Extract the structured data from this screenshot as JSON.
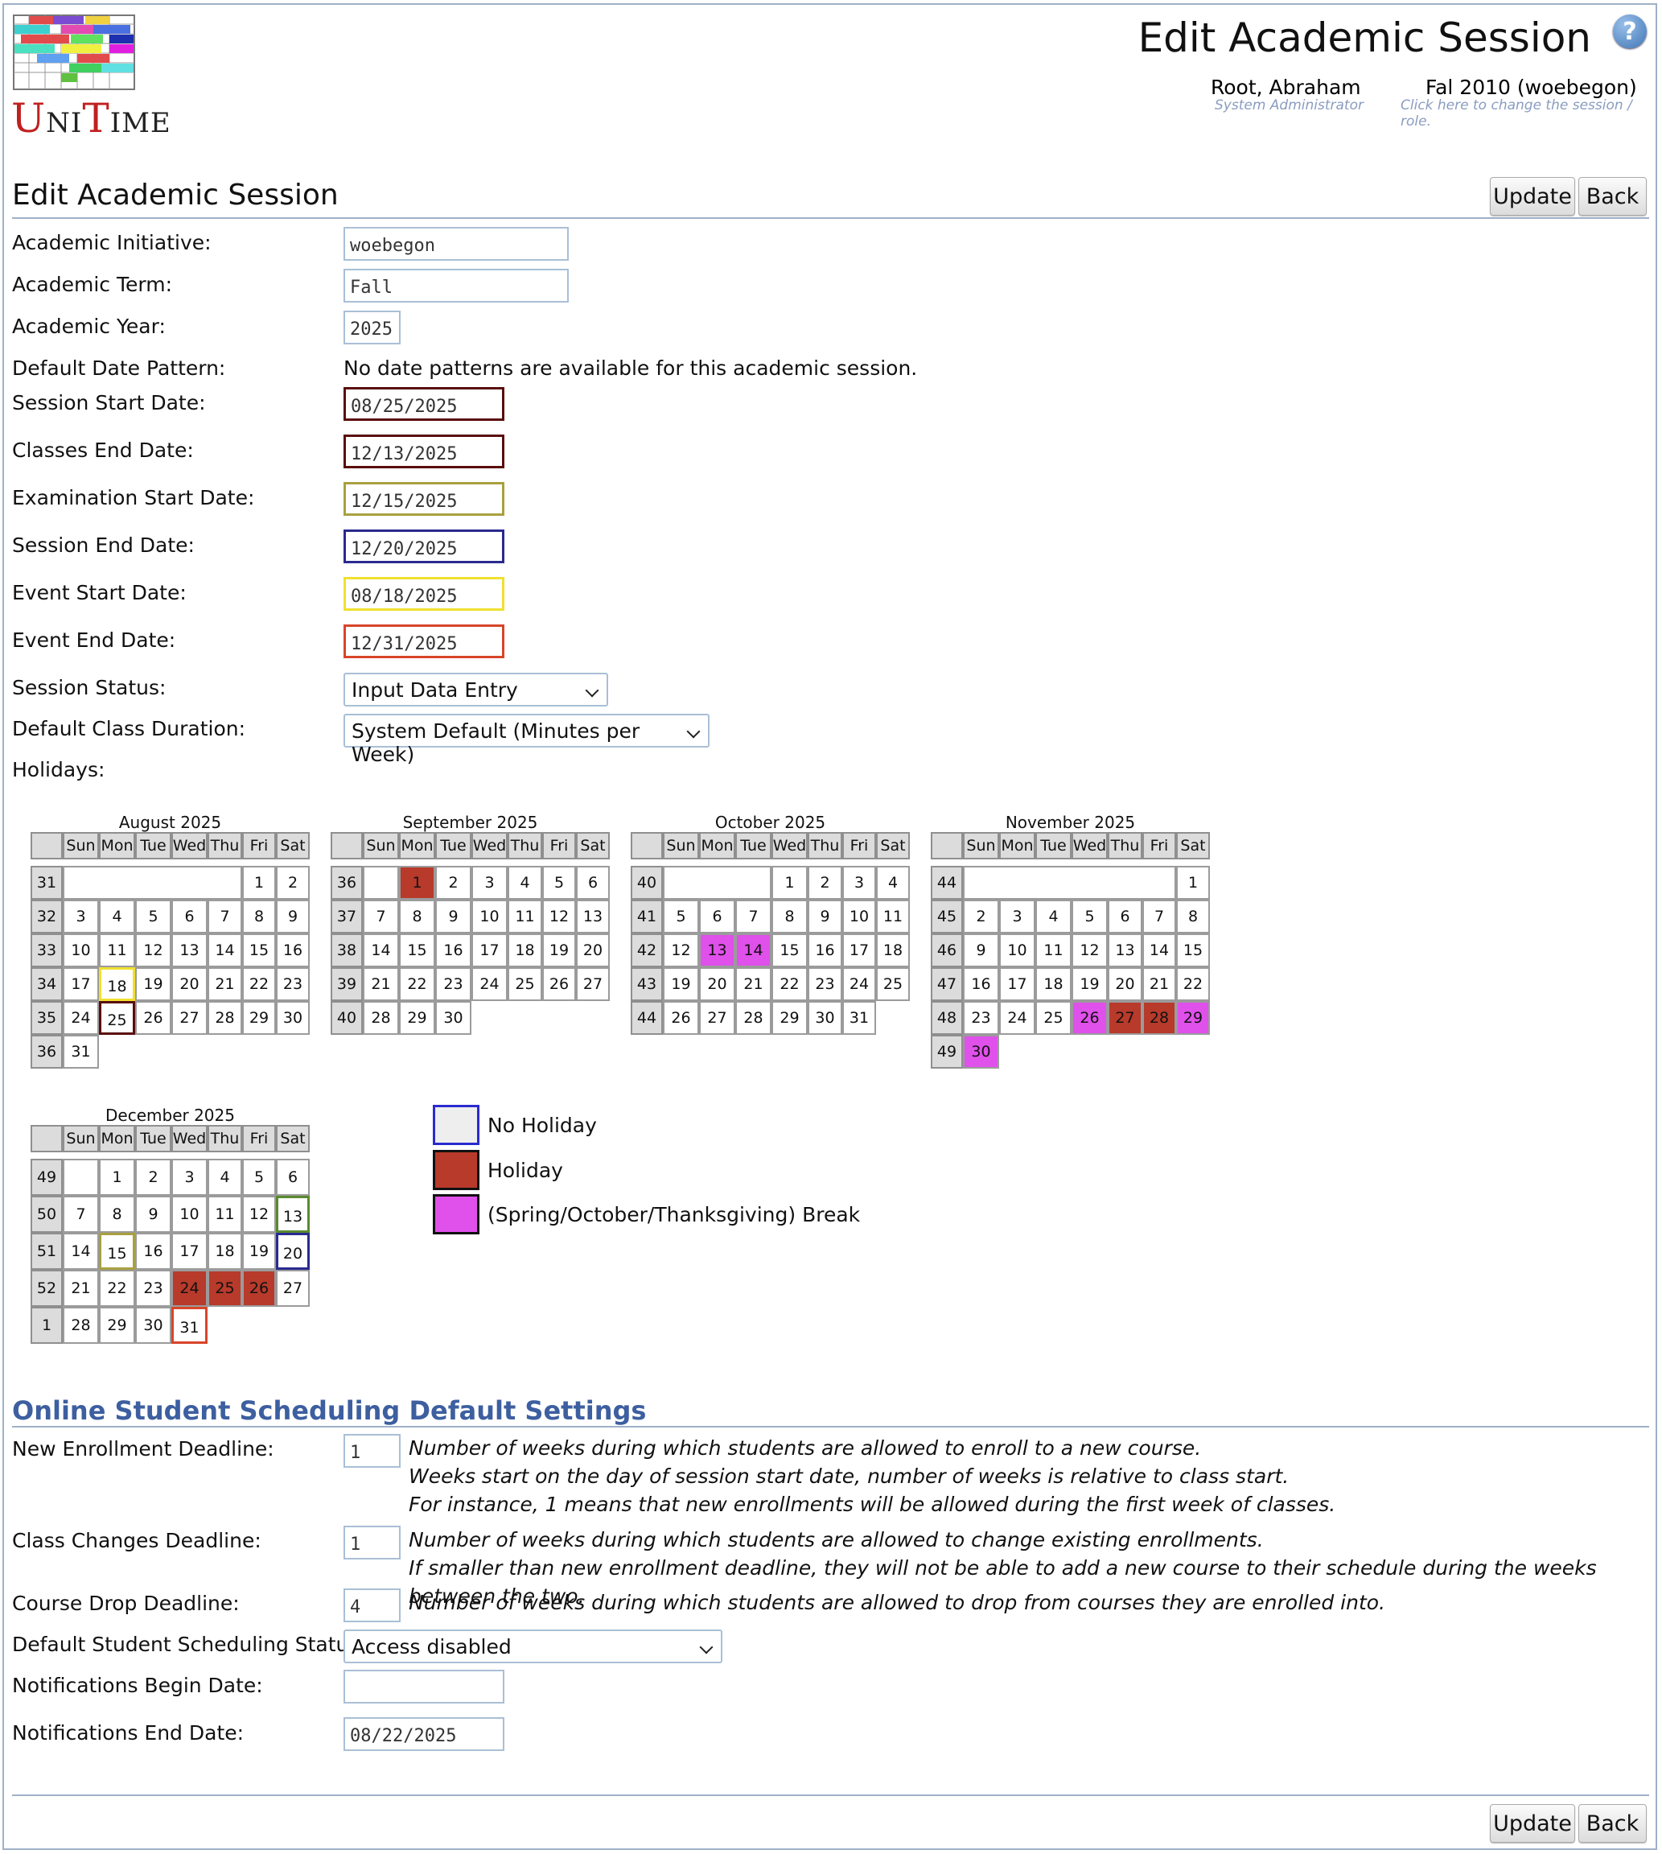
{
  "header": {
    "title": "Edit Academic Session",
    "logo_text": "UniTime",
    "user_name": "Root, Abraham",
    "user_role": "System Administrator",
    "session_name": "Fal 2010 (woebegon)",
    "session_hint": "Click here to change the session / role."
  },
  "section_title": "Edit Academic Session",
  "buttons": {
    "update": "Update",
    "back": "Back"
  },
  "form": {
    "initiative_label": "Academic Initiative:",
    "initiative_value": "woebegon",
    "term_label": "Academic Term:",
    "term_value": "Fall",
    "year_label": "Academic Year:",
    "year_value": "2025",
    "pattern_label": "Default Date Pattern:",
    "pattern_value": "No date patterns are available for this academic session.",
    "start_label": "Session Start Date:",
    "start_value": "08/25/2025",
    "classes_end_label": "Classes End Date:",
    "classes_end_value": "12/13/2025",
    "exam_start_label": "Examination Start Date:",
    "exam_start_value": "12/15/2025",
    "session_end_label": "Session End Date:",
    "session_end_value": "12/20/2025",
    "event_start_label": "Event Start Date:",
    "event_start_value": "08/18/2025",
    "event_end_label": "Event End Date:",
    "event_end_value": "12/31/2025",
    "status_label": "Session Status:",
    "status_value": "Input Data Entry",
    "duration_label": "Default Class Duration:",
    "duration_value": "System Default (Minutes per Week)",
    "holidays_label": "Holidays:"
  },
  "calendar": {
    "day_headers": [
      "Sun",
      "Mon",
      "Tue",
      "Wed",
      "Thu",
      "Fri",
      "Sat"
    ],
    "months": [
      {
        "title": "August 2025",
        "weeks": [
          31,
          32,
          33,
          34,
          35,
          36
        ],
        "first_dow": 5,
        "days": 31,
        "trailing_blank": false,
        "holidays": [],
        "breaks": [],
        "outlines": {
          "18": "#f0e030",
          "25": "#5a0d0d"
        }
      },
      {
        "title": "September 2025",
        "weeks": [
          36,
          37,
          38,
          39,
          40
        ],
        "first_dow": 1,
        "days": 30,
        "trailing_blank": false,
        "holidays": [
          1
        ],
        "breaks": [],
        "outlines": {}
      },
      {
        "title": "October 2025",
        "weeks": [
          40,
          41,
          42,
          43,
          44
        ],
        "first_dow": 3,
        "days": 31,
        "trailing_blank": false,
        "holidays": [],
        "breaks": [
          13,
          14
        ],
        "outlines": {}
      },
      {
        "title": "November 2025",
        "weeks": [
          44,
          45,
          46,
          47,
          48,
          49
        ],
        "first_dow": 6,
        "days": 30,
        "trailing_blank": false,
        "holidays": [
          27,
          28
        ],
        "breaks": [
          26,
          29,
          30
        ],
        "outlines": {}
      },
      {
        "title": "December 2025",
        "weeks": [
          49,
          50,
          51,
          52,
          1
        ],
        "first_dow": 1,
        "days": 31,
        "trailing_blank": false,
        "holidays": [
          24,
          25,
          26
        ],
        "breaks": [],
        "outlines": {
          "13": "#5a8a30",
          "15": "#a8a040",
          "20": "#2a2a90",
          "31": "#d8452a"
        }
      }
    ]
  },
  "legend": {
    "no_holiday": "No Holiday",
    "holiday": "Holiday",
    "break": "(Spring/October/Thanksgiving) Break"
  },
  "colors": {
    "start": "#5a0d0d",
    "classes_end": "#5a0d0d",
    "exam_start": "#a8a040",
    "session_end": "#2a2a90",
    "event_start": "#f0e030",
    "event_end": "#d8452a",
    "holiday": "#b83a2b",
    "break": "#e050ea",
    "no_holiday_border": "#2a2ad0"
  },
  "sched": {
    "title": "Online Student Scheduling Default Settings",
    "new_enroll_label": "New Enrollment Deadline:",
    "new_enroll_value": "1",
    "new_enroll_note1": "Number of weeks during which students are allowed to enroll to a new course.",
    "new_enroll_note2": "Weeks start on the day of session start date, number of weeks is relative to class start.",
    "new_enroll_note3": "For instance, 1 means that new enrollments will be allowed during the first week of classes.",
    "class_change_label": "Class Changes Deadline:",
    "class_change_value": "1",
    "class_change_note1": "Number of weeks during which students are allowed to change existing enrollments.",
    "class_change_note2": "If smaller than new enrollment deadline, they will not be able to add a new course to their schedule during the weeks between the two.",
    "drop_label": "Course Drop Deadline:",
    "drop_value": "4",
    "drop_note": "Number of weeks during which students are allowed to drop from courses they are enrolled into.",
    "status_label": "Default Student Scheduling Status:",
    "status_value": "Access disabled",
    "notif_begin_label": "Notifications Begin Date:",
    "notif_begin_value": "",
    "notif_end_label": "Notifications End Date:",
    "notif_end_value": "08/22/2025"
  }
}
